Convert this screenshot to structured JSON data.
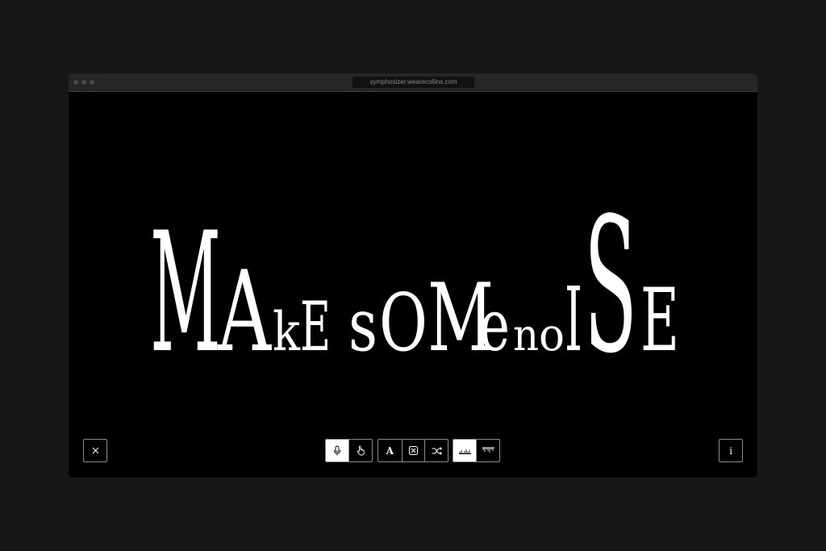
{
  "browser": {
    "url": "symphosizer.wearecollins.com"
  },
  "headline": {
    "text": "MAkE sOMe noISE",
    "glyphs": [
      "M",
      "A",
      "k",
      "E",
      "s",
      "O",
      "M",
      "e",
      "n",
      "o",
      "I",
      "S",
      "E"
    ]
  },
  "toolbar": {
    "close_icon": "close-icon",
    "input_mode": {
      "options": [
        "microphone-icon",
        "hand-pointer-icon"
      ],
      "selected": "microphone-icon"
    },
    "text_tools": {
      "font_label": "A",
      "items": [
        "font-icon",
        "boxed-x-icon",
        "shuffle-icon"
      ]
    },
    "visual_mode": {
      "options": [
        "waveform-icon",
        "spikes-icon"
      ],
      "selected": "waveform-icon"
    },
    "info_label": "i"
  },
  "colors": {
    "page_background": "#171717",
    "canvas_background": "#000000",
    "titlebar": "#262626",
    "text": "#ffffff",
    "border": "#8a8a8a"
  }
}
